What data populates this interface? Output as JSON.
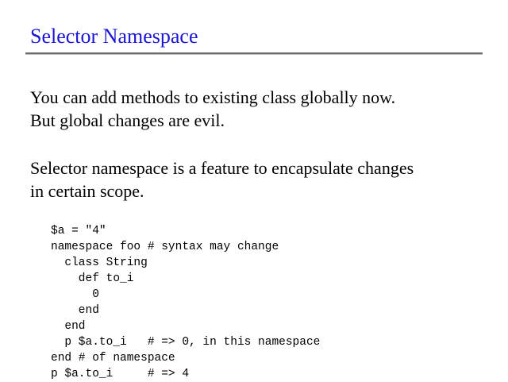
{
  "slide": {
    "title": "Selector Namespace",
    "paragraphs": [
      {
        "lines": [
          "You can add methods to existing class globally now.",
          "But global changes are evil."
        ]
      },
      {
        "lines": [
          "Selector namespace is a feature to encapsulate changes",
          "in certain scope."
        ]
      }
    ],
    "code_lines": [
      "$a = \"4\"",
      "namespace foo # syntax may change",
      "  class String",
      "    def to_i",
      "      0",
      "    end",
      "  end",
      "  p $a.to_i   # => 0, in this namespace",
      "end # of namespace",
      "p $a.to_i     # => 4"
    ]
  },
  "colors": {
    "title": "#1a14d6",
    "rule": "#707070",
    "text": "#000000",
    "background": "#ffffff"
  }
}
